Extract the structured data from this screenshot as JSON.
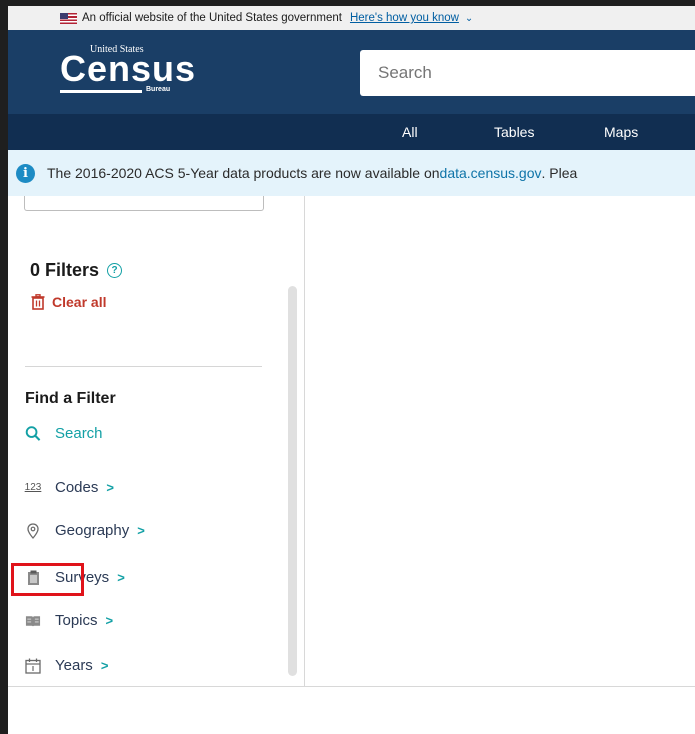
{
  "gov_banner": {
    "text": "An official website of the United States government",
    "link": "Here's how you know"
  },
  "header": {
    "logo": {
      "top": "United States",
      "main": "Census",
      "bottom": "Bureau"
    },
    "search_placeholder": "Search"
  },
  "nav": {
    "items": [
      "All",
      "Tables",
      "Maps"
    ]
  },
  "alert": {
    "text": "The 2016-2020 ACS 5-Year data products are now available on ",
    "link": "data.census.gov",
    "tail": ". Plea"
  },
  "filters": {
    "title": "0 Filters",
    "clear_all": "Clear all"
  },
  "find_filter": {
    "title": "Find a Filter",
    "search": "Search",
    "codes_icon_text": "123",
    "items": [
      "Codes",
      "Geography",
      "Surveys",
      "Topics",
      "Years"
    ]
  },
  "colors": {
    "header": "#1a3e66",
    "nav": "#112e51",
    "alert_bg": "#e4f3fb",
    "accent_teal": "#12a0a5",
    "clear_red": "#c0392b",
    "highlight": "#e0131a"
  }
}
